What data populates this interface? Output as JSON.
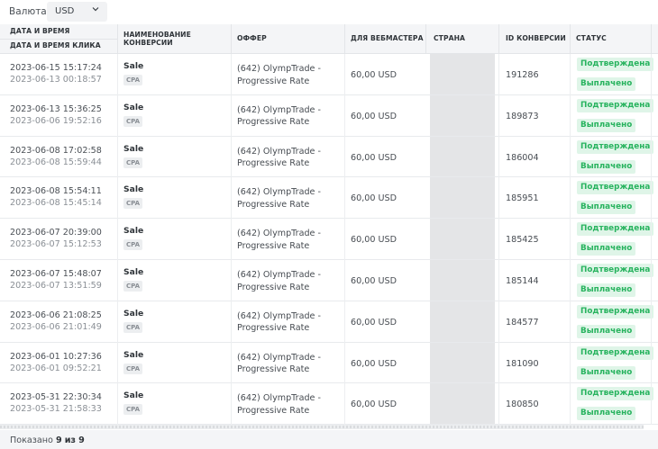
{
  "filters": {
    "currency_label": "Валюта",
    "currency_value": "USD",
    "chevron_icon": "chevron-down-icon"
  },
  "columns": {
    "datetime": "Дата и время",
    "click_datetime": "Дата и время клика",
    "conversion_name": "Наименование конверсии",
    "offer": "Оффер",
    "webmaster_payout": "Для вебмастера",
    "country": "Страна",
    "conversion_id": "ID конверсии",
    "status": "Статус"
  },
  "rows": [
    {
      "datetime": "2023-06-15 15:17:24",
      "click_datetime": "2023-06-13 00:18:57",
      "conversion": "Sale",
      "type": "CPA",
      "offer": "(642) OlympTrade - Progressive Rate",
      "payout": "60,00 USD",
      "id": "191286",
      "status": "Подтверждена",
      "payment": "Выплачено"
    },
    {
      "datetime": "2023-06-13 15:36:25",
      "click_datetime": "2023-06-06 19:52:16",
      "conversion": "Sale",
      "type": "CPA",
      "offer": "(642) OlympTrade - Progressive Rate",
      "payout": "60,00 USD",
      "id": "189873",
      "status": "Подтверждена",
      "payment": "Выплачено"
    },
    {
      "datetime": "2023-06-08 17:02:58",
      "click_datetime": "2023-06-08 15:59:44",
      "conversion": "Sale",
      "type": "CPA",
      "offer": "(642) OlympTrade - Progressive Rate",
      "payout": "60,00 USD",
      "id": "186004",
      "status": "Подтверждена",
      "payment": "Выплачено"
    },
    {
      "datetime": "2023-06-08 15:54:11",
      "click_datetime": "2023-06-08 15:45:14",
      "conversion": "Sale",
      "type": "CPA",
      "offer": "(642) OlympTrade - Progressive Rate",
      "payout": "60,00 USD",
      "id": "185951",
      "status": "Подтверждена",
      "payment": "Выплачено"
    },
    {
      "datetime": "2023-06-07 20:39:00",
      "click_datetime": "2023-06-07 15:12:53",
      "conversion": "Sale",
      "type": "CPA",
      "offer": "(642) OlympTrade - Progressive Rate",
      "payout": "60,00 USD",
      "id": "185425",
      "status": "Подтверждена",
      "payment": "Выплачено"
    },
    {
      "datetime": "2023-06-07 15:48:07",
      "click_datetime": "2023-06-07 13:51:59",
      "conversion": "Sale",
      "type": "CPA",
      "offer": "(642) OlympTrade - Progressive Rate",
      "payout": "60,00 USD",
      "id": "185144",
      "status": "Подтверждена",
      "payment": "Выплачено"
    },
    {
      "datetime": "2023-06-06 21:08:25",
      "click_datetime": "2023-06-06 21:01:49",
      "conversion": "Sale",
      "type": "CPA",
      "offer": "(642) OlympTrade - Progressive Rate",
      "payout": "60,00 USD",
      "id": "184577",
      "status": "Подтверждена",
      "payment": "Выплачено"
    },
    {
      "datetime": "2023-06-01 10:27:36",
      "click_datetime": "2023-06-01 09:52:21",
      "conversion": "Sale",
      "type": "CPA",
      "offer": "(642) OlympTrade - Progressive Rate",
      "payout": "60,00 USD",
      "id": "181090",
      "status": "Подтверждена",
      "payment": "Выплачено"
    },
    {
      "datetime": "2023-05-31 22:30:34",
      "click_datetime": "2023-05-31 21:58:33",
      "conversion": "Sale",
      "type": "CPA",
      "offer": "(642) OlympTrade - Progressive Rate",
      "payout": "60,00 USD",
      "id": "180850",
      "status": "Подтверждена",
      "payment": "Выплачено"
    }
  ],
  "footer": {
    "shown_prefix": "Показано",
    "shown_count": "9",
    "shown_of": "из",
    "shown_total": "9"
  },
  "colors": {
    "status_text": "#27b35e",
    "status_bg": "#dff5e8",
    "header_bg": "#f4f5f7"
  }
}
